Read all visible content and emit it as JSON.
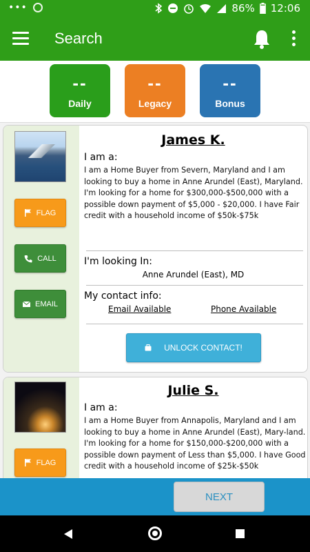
{
  "status_bar": {
    "battery": "86%",
    "time": "12:06"
  },
  "app_bar": {
    "title": "Search"
  },
  "stats": [
    {
      "value": "--",
      "label": "Daily",
      "color": "#2a9e1b"
    },
    {
      "value": "--",
      "label": "Legacy",
      "color": "#ec7f23"
    },
    {
      "value": "--",
      "label": "Bonus",
      "color": "#2a74b2"
    }
  ],
  "leads": [
    {
      "name": "James K.",
      "iam_label": "I am a:",
      "description": "I am a Home Buyer from Severn, Maryland and I am looking to buy a home in Anne Arundel (East), Maryland. I'm looking for a home for $300,000-$500,000 with a possible down payment of $5,000 - $20,000. I have Fair credit with a household income of $50k-$75k",
      "flag_label": "FLAG",
      "call_label": "CALL",
      "email_label": "EMAIL",
      "looking_label": "I'm looking In:",
      "location": "Anne Arundel (East), MD",
      "contact_label": "My contact info:",
      "email_available": "Email Available",
      "phone_available": "Phone Available",
      "unlock_label": "UNLOCK CONTACT!"
    },
    {
      "name": "Julie S.",
      "iam_label": "I am a:",
      "description": "I am a Home Buyer from Annapolis, Maryland and I am looking to buy a home in Anne Arundel (East), Mary-land. I'm looking for a home for $150,000-$200,000 with a possible down payment of Less than $5,000. I have Good credit with a household income of $25k-$50k",
      "flag_label": "FLAG"
    }
  ],
  "bottom": {
    "next_label": "NEXT"
  },
  "colors": {
    "primary_green": "#2f9e18",
    "flag_orange": "#f79a1a",
    "action_green": "#3e8e3a",
    "unlock_blue": "#3fb0d9",
    "bottom_blue": "#1b93c9"
  }
}
